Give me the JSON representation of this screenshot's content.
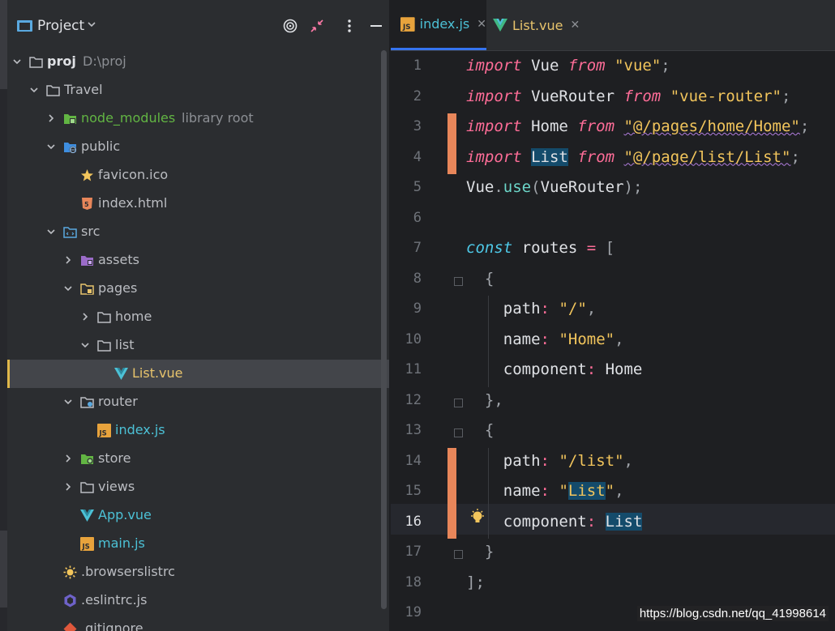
{
  "panel": {
    "title": "Project",
    "tree": [
      {
        "label": "proj",
        "extra": "D:\\proj",
        "icon": "folder-icon",
        "depth": 0,
        "expanded": true
      },
      {
        "label": "Travel",
        "icon": "folder-icon",
        "depth": 1,
        "expanded": true
      },
      {
        "label": "node_modules",
        "extra": "library root",
        "icon": "node-modules-folder-icon",
        "depth": 2,
        "expanded": false
      },
      {
        "label": "public",
        "icon": "web-folder-icon",
        "depth": 2,
        "expanded": true
      },
      {
        "label": "favicon.ico",
        "icon": "star-icon",
        "depth": 3
      },
      {
        "label": "index.html",
        "icon": "html5-icon",
        "depth": 3
      },
      {
        "label": "src",
        "icon": "source-folder-icon",
        "depth": 2,
        "expanded": true
      },
      {
        "label": "assets",
        "icon": "assets-folder-icon",
        "depth": 3,
        "expanded": false
      },
      {
        "label": "pages",
        "icon": "pages-folder-icon",
        "depth": 3,
        "expanded": true
      },
      {
        "label": "home",
        "icon": "folder-icon",
        "depth": 4,
        "expanded": false
      },
      {
        "label": "list",
        "icon": "folder-icon",
        "depth": 4,
        "expanded": true
      },
      {
        "label": "List.vue",
        "icon": "vue-icon",
        "depth": 5,
        "selected": true
      },
      {
        "label": "router",
        "icon": "router-folder-icon",
        "depth": 3,
        "expanded": true
      },
      {
        "label": "index.js",
        "icon": "js-file-icon",
        "depth": 4
      },
      {
        "label": "store",
        "icon": "store-folder-icon",
        "depth": 3,
        "expanded": false
      },
      {
        "label": "views",
        "icon": "folder-icon",
        "depth": 3,
        "expanded": false
      },
      {
        "label": "App.vue",
        "icon": "vue-icon",
        "depth": 3
      },
      {
        "label": "main.js",
        "icon": "js-file-icon",
        "depth": 3
      },
      {
        "label": ".browserslistrc",
        "icon": "browserslist-icon",
        "depth": 2
      },
      {
        "label": ".eslintrc.js",
        "icon": "eslint-icon",
        "depth": 2
      },
      {
        "label": ".gitignore",
        "icon": "git-icon",
        "depth": 2
      }
    ]
  },
  "tabs": [
    {
      "label": "index.js",
      "icon": "js-file-icon",
      "active": true
    },
    {
      "label": "List.vue",
      "icon": "vue-icon",
      "active": false
    }
  ],
  "editor": {
    "current_line": 16,
    "changed_lines": [
      3,
      4,
      14,
      15,
      16
    ],
    "line_numbers": [
      "1",
      "2",
      "3",
      "4",
      "5",
      "6",
      "7",
      "8",
      "9",
      "10",
      "11",
      "12",
      "13",
      "14",
      "15",
      "16",
      "17",
      "18",
      "19"
    ],
    "code": [
      [
        [
          "kw",
          "import"
        ],
        [
          "plain",
          " Vue "
        ],
        [
          "kw",
          "from"
        ],
        [
          "plain",
          " "
        ],
        [
          "str",
          "\"vue\""
        ],
        [
          "punct",
          ";"
        ]
      ],
      [
        [
          "kw",
          "import"
        ],
        [
          "plain",
          " VueRouter "
        ],
        [
          "kw",
          "from"
        ],
        [
          "plain",
          " "
        ],
        [
          "str",
          "\"vue-router\""
        ],
        [
          "punct",
          ";"
        ]
      ],
      [
        [
          "kw",
          "import"
        ],
        [
          "plain",
          " Home "
        ],
        [
          "kw",
          "from"
        ],
        [
          "plain",
          " "
        ],
        [
          "str squig",
          "\"@/pages/home/Home\""
        ],
        [
          "punct",
          ";"
        ]
      ],
      [
        [
          "kw",
          "import"
        ],
        [
          "plain",
          " "
        ],
        [
          "plain hl",
          "List"
        ],
        [
          "plain",
          " "
        ],
        [
          "kw",
          "from"
        ],
        [
          "plain",
          " "
        ],
        [
          "str squig",
          "\"@/page/list/List\""
        ],
        [
          "punct",
          ";"
        ]
      ],
      [
        [
          "plain",
          "Vue"
        ],
        [
          "punct",
          "."
        ],
        [
          "meth",
          "use"
        ],
        [
          "punct",
          "("
        ],
        [
          "plain",
          "VueRouter"
        ],
        [
          "punct",
          ");"
        ]
      ],
      [],
      [
        [
          "kw2",
          "const"
        ],
        [
          "plain",
          " routes "
        ],
        [
          "op",
          "="
        ],
        [
          "plain",
          " "
        ],
        [
          "punct",
          "["
        ]
      ],
      [
        [
          "plain",
          "  "
        ],
        [
          "punct",
          "{"
        ]
      ],
      [
        [
          "plain",
          "    "
        ],
        [
          "key",
          "path"
        ],
        [
          "op",
          ":"
        ],
        [
          "plain",
          " "
        ],
        [
          "str",
          "\"/\""
        ],
        [
          "punct",
          ","
        ]
      ],
      [
        [
          "plain",
          "    "
        ],
        [
          "key",
          "name"
        ],
        [
          "op",
          ":"
        ],
        [
          "plain",
          " "
        ],
        [
          "str",
          "\"Home\""
        ],
        [
          "punct",
          ","
        ]
      ],
      [
        [
          "plain",
          "    "
        ],
        [
          "key",
          "component"
        ],
        [
          "op",
          ":"
        ],
        [
          "plain",
          " Home"
        ]
      ],
      [
        [
          "plain",
          "  "
        ],
        [
          "punct",
          "},"
        ]
      ],
      [
        [
          "plain",
          "  "
        ],
        [
          "punct",
          "{"
        ]
      ],
      [
        [
          "plain",
          "    "
        ],
        [
          "key",
          "path"
        ],
        [
          "op",
          ":"
        ],
        [
          "plain",
          " "
        ],
        [
          "str",
          "\"/list\""
        ],
        [
          "punct",
          ","
        ]
      ],
      [
        [
          "plain",
          "    "
        ],
        [
          "key",
          "name"
        ],
        [
          "op",
          ":"
        ],
        [
          "plain",
          " "
        ],
        [
          "str",
          "\""
        ],
        [
          "str hl",
          "List"
        ],
        [
          "str",
          "\""
        ],
        [
          "punct",
          ","
        ]
      ],
      [
        [
          "plain",
          "    "
        ],
        [
          "key",
          "component"
        ],
        [
          "op",
          ":"
        ],
        [
          "plain",
          " "
        ],
        [
          "plain hl",
          "List"
        ]
      ],
      [
        [
          "plain",
          "  "
        ],
        [
          "punct",
          "}"
        ]
      ],
      [
        [
          "punct",
          "];"
        ]
      ],
      []
    ]
  },
  "watermark": "https://blog.csdn.net/qq_41998614"
}
